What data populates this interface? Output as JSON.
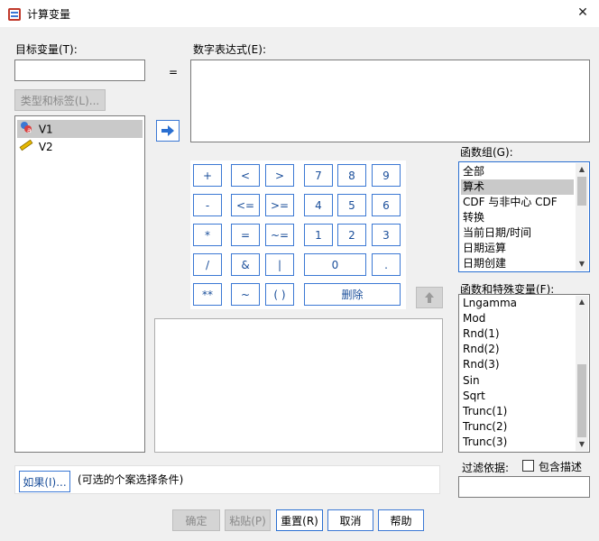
{
  "window": {
    "title": "计算变量",
    "close_glyph": "✕"
  },
  "target_var": {
    "label": "目标变量(T):",
    "value": ""
  },
  "type_label_button": "类型和标签(L)...",
  "equals": "=",
  "expression": {
    "label": "数字表达式(E):",
    "value": ""
  },
  "variables": [
    {
      "name": "V1",
      "icon": "nominal-variable-icon",
      "selected": true
    },
    {
      "name": "V2",
      "icon": "scale-variable-icon",
      "selected": false
    }
  ],
  "keypad": {
    "row1": [
      "+",
      "<",
      ">",
      "7",
      "8",
      "9"
    ],
    "row2": [
      "-",
      "<=",
      ">=",
      "4",
      "5",
      "6"
    ],
    "row3": [
      "*",
      "=",
      "~=",
      "1",
      "2",
      "3"
    ],
    "row4": [
      "/",
      "&",
      "|",
      "0",
      "."
    ],
    "row5": [
      "**",
      "~",
      "( )",
      "删除"
    ]
  },
  "function_groups": {
    "label": "函数组(G):",
    "items": [
      "全部",
      "算术",
      "CDF 与非中心 CDF",
      "转换",
      "当前日期/时间",
      "日期运算",
      "日期创建"
    ],
    "selected_index": 1
  },
  "functions": {
    "label": "函数和特殊变量(F):",
    "items": [
      "Lngamma",
      "Mod",
      "Rnd(1)",
      "Rnd(2)",
      "Rnd(3)",
      "Sin",
      "Sqrt",
      "Trunc(1)",
      "Trunc(2)",
      "Trunc(3)"
    ]
  },
  "filter": {
    "label": "过滤依据:",
    "include_desc_label": "包含描述",
    "include_desc_checked": false,
    "value": ""
  },
  "if_button": "如果(I)...",
  "if_hint": "(可选的个案选择条件)",
  "buttons": {
    "ok": "确定",
    "paste": "粘贴(P)",
    "reset": "重置(R)",
    "cancel": "取消",
    "help": "帮助"
  },
  "colors": {
    "accent": "#3b78d4",
    "selection": "#c9c9c9",
    "background": "#f0f0f0"
  }
}
